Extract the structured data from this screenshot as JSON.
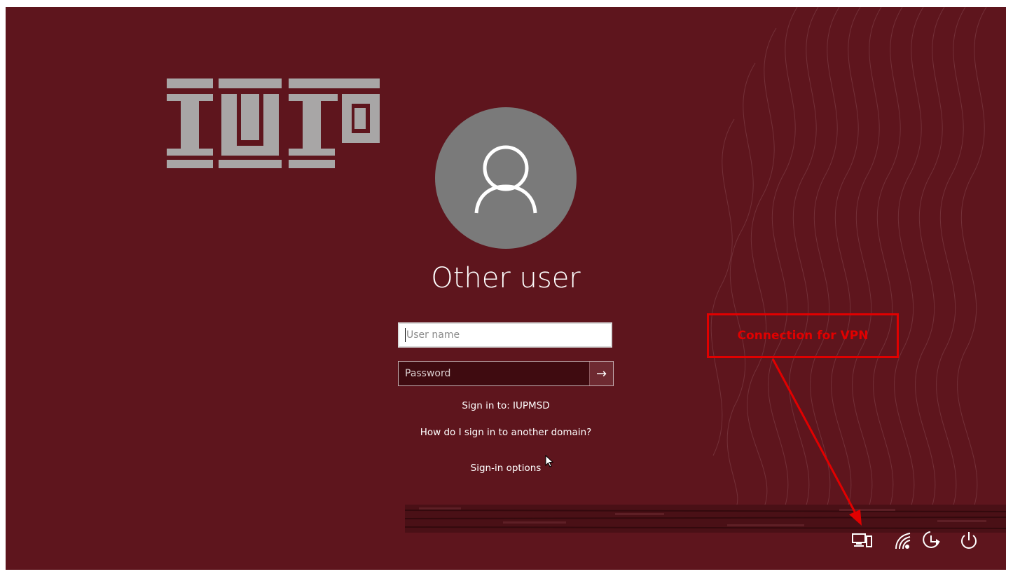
{
  "logo": {
    "text": "IUP"
  },
  "user": {
    "name": "Other user"
  },
  "fields": {
    "username_placeholder": "User name",
    "password_placeholder": "Password",
    "submit_symbol": "→"
  },
  "links": {
    "sign_in_to": "Sign in to: IUPMSD",
    "domain_help": "How do I sign in to another domain?",
    "sign_in_options": "Sign-in options"
  },
  "annotation": {
    "label": "Connection for VPN",
    "color": "#e10000"
  },
  "tray": {
    "icons": [
      "network-icon",
      "wifi-icon",
      "accessibility-icon",
      "power-icon"
    ]
  },
  "colors": {
    "background": "#5e151d",
    "avatar": "#7a7a7a",
    "logo": "#a8a6a6"
  }
}
